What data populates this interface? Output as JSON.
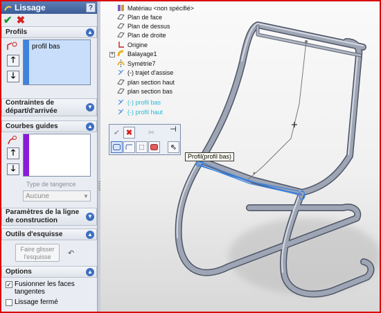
{
  "pm": {
    "title": "Lissage",
    "help": "?",
    "ok": "✔",
    "cancel": "✖",
    "groups": {
      "profils": "Profils",
      "contraintes": "Contraintes de départ/d'arrivée",
      "courbes": "Courbes guides",
      "parametres": "Paramètres de la ligne de construction",
      "outils": "Outils d'esquisse",
      "options": "Options"
    },
    "profiles_list": [
      "profil bas"
    ],
    "tangency_type_label": "Type de tangence",
    "tangency_type_value": "Aucune",
    "drag_sketch_button": "Faire glisser l'esquisse",
    "checkboxes": [
      {
        "label": "Fusionner les faces tangentes",
        "checked": true
      },
      {
        "label": "Lissage fermé",
        "checked": false
      }
    ]
  },
  "tree": {
    "items": [
      {
        "label": "Matériau <non spécifié>",
        "icon": "material-icon"
      },
      {
        "label": "Plan de face",
        "icon": "plane-icon"
      },
      {
        "label": "Plan de dessus",
        "icon": "plane-icon"
      },
      {
        "label": "Plan de droite",
        "icon": "plane-icon"
      },
      {
        "label": "Origine",
        "icon": "origin-icon"
      },
      {
        "label": "Balayage1",
        "icon": "sweep-icon"
      },
      {
        "label": "Symétrie7",
        "icon": "mirror-icon"
      },
      {
        "label": "(-) trajet d'assise",
        "icon": "sketch-icon"
      },
      {
        "label": "plan section haut",
        "icon": "plane-icon"
      },
      {
        "label": "plan section bas",
        "icon": "plane-icon"
      },
      {
        "label": "(-) profil bas",
        "icon": "sketch-icon"
      },
      {
        "label": "(-) profil haut",
        "icon": "sketch-icon"
      }
    ]
  },
  "tooltip": "Profil(profil bas)",
  "colors": {
    "accent": "#3d6fc0",
    "selection_blue": "#3f83dd",
    "guide_purple": "#8a1bd8",
    "highlight_cyan": "#29b8d8",
    "frame_red": "#d90000"
  }
}
